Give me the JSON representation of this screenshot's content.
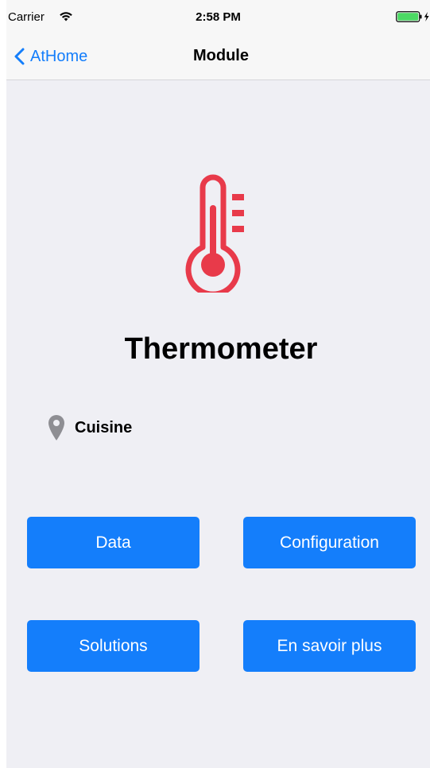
{
  "status_bar": {
    "carrier": "Carrier",
    "time": "2:58 PM",
    "wifi_icon": "wifi-icon",
    "battery_icon": "battery-charging-icon",
    "battery_color": "#4cd964"
  },
  "nav": {
    "back_label": "AtHome",
    "title": "Module",
    "back_icon": "chevron-left-icon"
  },
  "module": {
    "icon": "thermometer-icon",
    "icon_color": "#e83a4a",
    "name": "Thermometer",
    "location_icon": "map-pin-icon",
    "location": "Cuisine"
  },
  "buttons": {
    "data": "Data",
    "configuration": "Configuration",
    "solutions": "Solutions",
    "learn_more": "En savoir plus"
  },
  "colors": {
    "accent": "#147efb",
    "background": "#efeff4",
    "pin": "#8e8e93"
  }
}
